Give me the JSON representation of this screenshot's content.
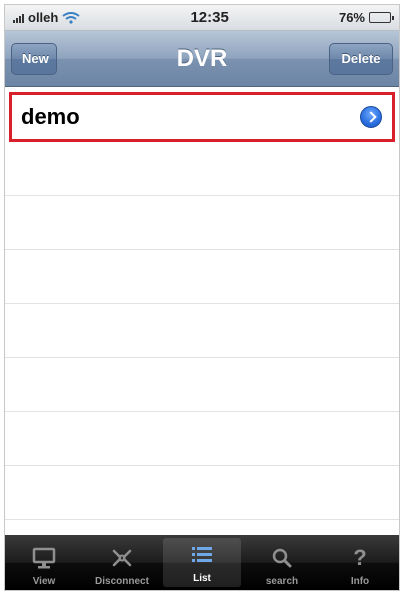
{
  "status_bar": {
    "carrier": "olleh",
    "time": "12:35",
    "battery_text": "76%",
    "battery_level": 0.76
  },
  "navbar": {
    "title": "DVR",
    "left_button": "New",
    "right_button": "Delete"
  },
  "list": {
    "items": [
      {
        "label": "demo"
      }
    ],
    "empty_rows": 8
  },
  "tabbar": {
    "tabs": [
      {
        "label": "View",
        "icon": "monitor-icon",
        "selected": false
      },
      {
        "label": "Disconnect",
        "icon": "disconnect-icon",
        "selected": false
      },
      {
        "label": "List",
        "icon": "list-icon",
        "selected": true
      },
      {
        "label": "search",
        "icon": "search-icon",
        "selected": false
      },
      {
        "label": "Info",
        "icon": "question-icon",
        "selected": false
      }
    ]
  },
  "colors": {
    "highlight_border": "#d8202a",
    "navbar": "#7b92b0",
    "tabbar": "#1c1c1c",
    "disclosure": "#2a6fdf"
  }
}
